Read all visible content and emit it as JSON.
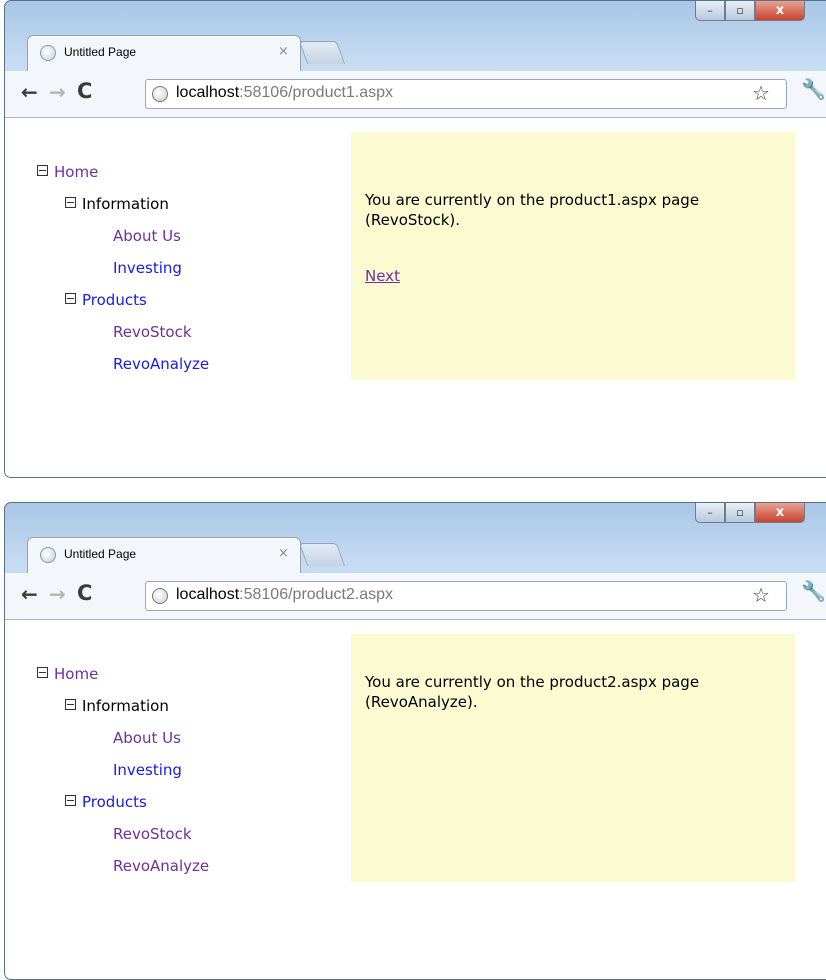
{
  "windows": [
    {
      "tab": {
        "title": "Untitled Page",
        "close": "×"
      },
      "url": {
        "host": "localhost",
        "rest": ":58106/product1.aspx"
      },
      "nav": {
        "back": "←",
        "forward": "→",
        "reload": "C"
      },
      "tree": {
        "home": "Home",
        "information": "Information",
        "about_us": "About Us",
        "investing": "Investing",
        "products": "Products",
        "revostock": "RevoStock",
        "revoanalyze": "RevoAnalyze"
      },
      "panel": {
        "message": "You are currently on the product1.aspx page (RevoStock).",
        "link": "Next"
      }
    },
    {
      "tab": {
        "title": "Untitled Page",
        "close": "×"
      },
      "url": {
        "host": "localhost",
        "rest": ":58106/product2.aspx"
      },
      "nav": {
        "back": "←",
        "forward": "→",
        "reload": "C"
      },
      "tree": {
        "home": "Home",
        "information": "Information",
        "about_us": "About Us",
        "investing": "Investing",
        "products": "Products",
        "revostock": "RevoStock",
        "revoanalyze": "RevoAnalyze"
      },
      "panel": {
        "message": "You are currently on the product2.aspx page (RevoAnalyze)."
      }
    }
  ],
  "window_controls": {
    "minimize": "–",
    "maximize": "▫",
    "close": "x"
  },
  "icons": {
    "bookmark": "star-icon",
    "settings": "wrench-icon",
    "favicon": "globe-icon",
    "tree_toggle": "collapse-minus-icon"
  },
  "colors": {
    "visited_link": "#6f2fa0",
    "unvisited_link": "#1a1ae6",
    "panel_bg": "#fbfad0",
    "frame": "#c5dbf1"
  }
}
